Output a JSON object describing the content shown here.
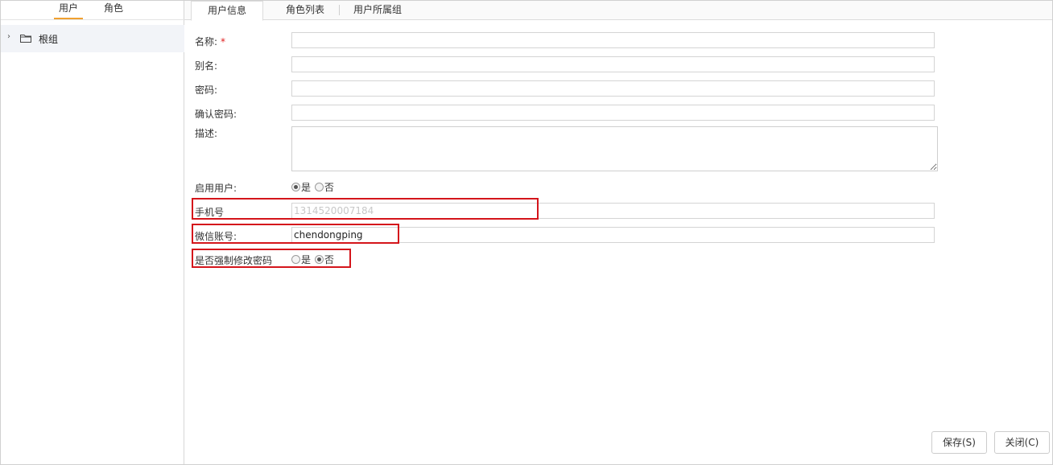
{
  "left_tabs": [
    {
      "label": "用户"
    },
    {
      "label": "角色"
    }
  ],
  "tree": {
    "root_label": "根组"
  },
  "tabs": [
    {
      "label": "用户信息"
    },
    {
      "label": "角色列表"
    },
    {
      "label": "用户所属组"
    }
  ],
  "form": {
    "name_label": "名称:",
    "required_mark": "*",
    "alias_label": "别名:",
    "password_label": "密码:",
    "confirm_label": "确认密码:",
    "desc_label": "描述:",
    "enabled_label": "启用用户:",
    "enabled_yes": "是",
    "enabled_no": "否",
    "phone_label": "手机号",
    "phone_value": "1314520007184",
    "wechat_label": "微信账号:",
    "wechat_value": "chendongping",
    "force_label": "是否强制修改密码",
    "force_yes": "是",
    "force_no": "否"
  },
  "buttons": {
    "save": "保存(S)",
    "close": "关闭(C)"
  },
  "colors": {
    "accent": "#f0a030",
    "highlight": "#d4151b"
  }
}
